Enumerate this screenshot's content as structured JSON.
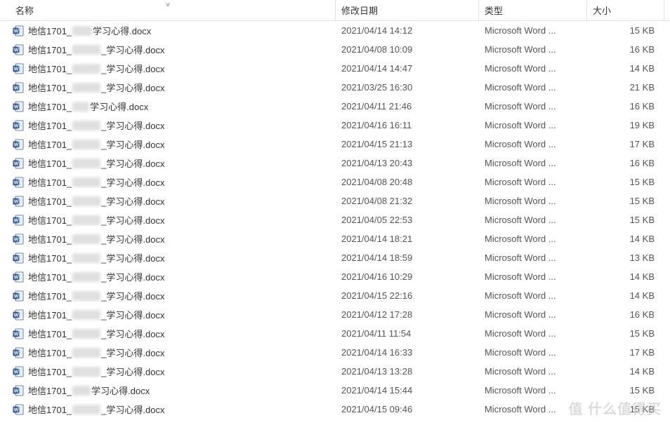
{
  "headers": {
    "name": "名称",
    "date": "修改日期",
    "type": "类型",
    "size": "大小"
  },
  "type_label": "Microsoft Word ...",
  "filename_prefix": "地信1701_",
  "filename_suffix": "_学习心得.docx",
  "files": [
    {
      "redact_w": 28,
      "visible_tail": "学习心得.docx",
      "date": "2021/04/14 14:12",
      "size": "15 KB"
    },
    {
      "redact_w": 40,
      "visible_tail": "_学习心得.docx",
      "date": "2021/04/08 10:09",
      "size": "16 KB"
    },
    {
      "redact_w": 40,
      "visible_tail": "_学习心得.docx",
      "date": "2021/04/14 14:47",
      "size": "14 KB"
    },
    {
      "redact_w": 40,
      "visible_tail": "_学习心得.docx",
      "date": "2021/03/25 16:30",
      "size": "21 KB"
    },
    {
      "redact_w": 24,
      "visible_tail": "学习心得.docx",
      "date": "2021/04/11 21:46",
      "size": "16 KB"
    },
    {
      "redact_w": 40,
      "visible_tail": "_学习心得.docx",
      "date": "2021/04/16 16:11",
      "size": "19 KB"
    },
    {
      "redact_w": 40,
      "visible_tail": "_学习心得.docx",
      "date": "2021/04/15 21:13",
      "size": "17 KB"
    },
    {
      "redact_w": 40,
      "visible_tail": "_学习心得.docx",
      "date": "2021/04/13 20:43",
      "size": "16 KB"
    },
    {
      "redact_w": 40,
      "visible_tail": "_学习心得.docx",
      "date": "2021/04/08 20:48",
      "size": "15 KB"
    },
    {
      "redact_w": 40,
      "visible_tail": "_学习心得.docx",
      "date": "2021/04/08 21:32",
      "size": "15 KB"
    },
    {
      "redact_w": 40,
      "visible_tail": "_学习心得.docx",
      "date": "2021/04/05 22:53",
      "size": "15 KB"
    },
    {
      "redact_w": 40,
      "visible_tail": "_学习心得.docx",
      "date": "2021/04/14 18:21",
      "size": "14 KB"
    },
    {
      "redact_w": 40,
      "visible_tail": "_学习心得.docx",
      "date": "2021/04/14 18:59",
      "size": "13 KB"
    },
    {
      "redact_w": 40,
      "visible_tail": "_学习心得.docx",
      "date": "2021/04/16 10:29",
      "size": "14 KB"
    },
    {
      "redact_w": 40,
      "visible_tail": "_学习心得.docx",
      "date": "2021/04/15 22:16",
      "size": "14 KB"
    },
    {
      "redact_w": 40,
      "visible_tail": "_学习心得.docx",
      "date": "2021/04/12 17:28",
      "size": "16 KB"
    },
    {
      "redact_w": 40,
      "visible_tail": "_学习心得.docx",
      "date": "2021/04/11 11:54",
      "size": "15 KB"
    },
    {
      "redact_w": 40,
      "visible_tail": "_学习心得.docx",
      "date": "2021/04/14 16:33",
      "size": "17 KB"
    },
    {
      "redact_w": 40,
      "visible_tail": "_学习心得.docx",
      "date": "2021/04/13 13:28",
      "size": "14 KB"
    },
    {
      "redact_w": 26,
      "visible_tail": "学习心得.docx",
      "date": "2021/04/14 15:44",
      "size": "15 KB"
    },
    {
      "redact_w": 40,
      "visible_tail": "_学习心得.docx",
      "date": "2021/04/15 09:46",
      "size": "15 KB"
    }
  ],
  "watermark": {
    "main": "值 什么值得买",
    "sub": ""
  }
}
